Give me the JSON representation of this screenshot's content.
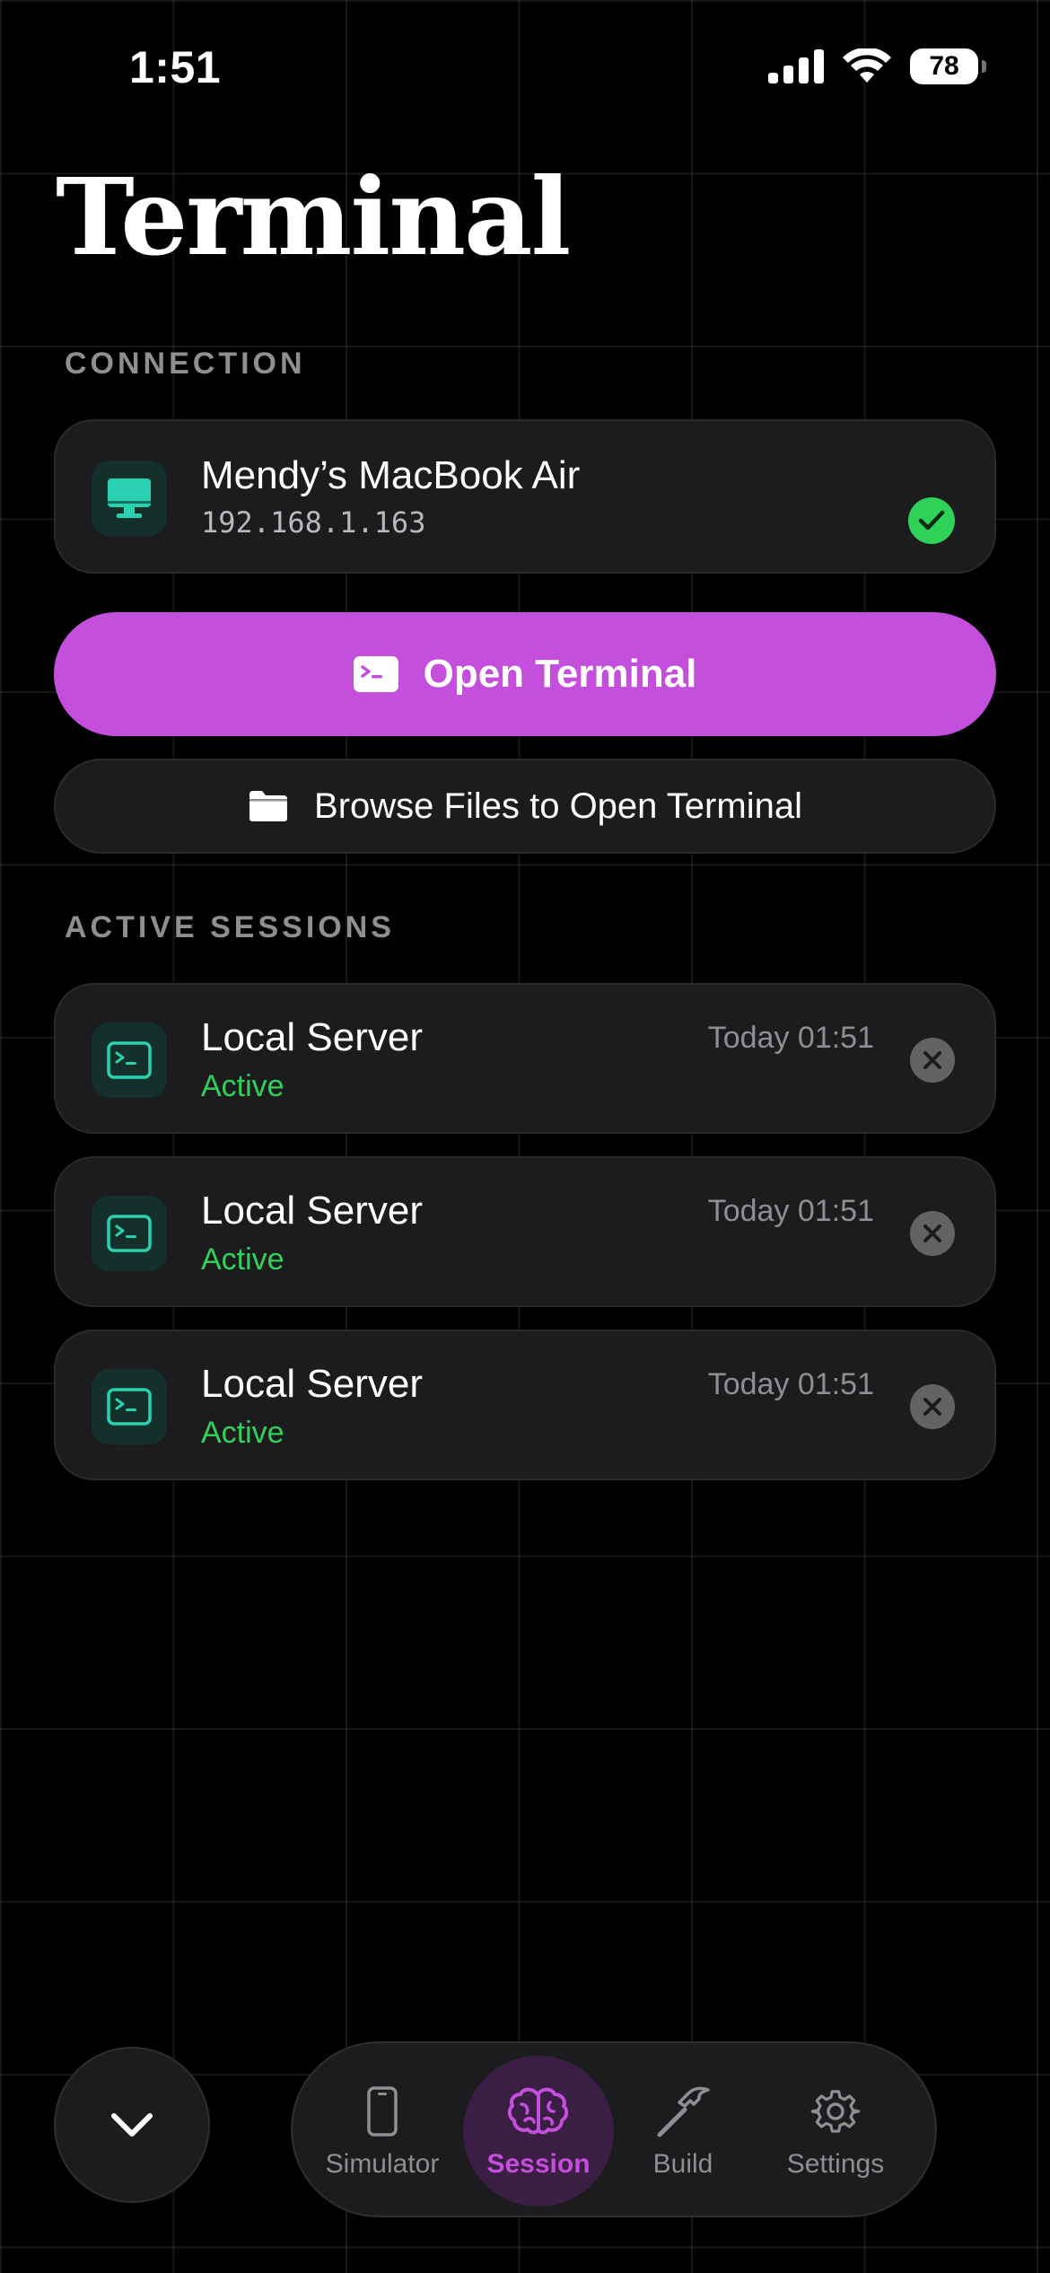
{
  "status_bar": {
    "time": "1:51",
    "battery": "78"
  },
  "page": {
    "title": "Terminal"
  },
  "connection": {
    "section_label": "CONNECTION",
    "device_name": "Mendy’s MacBook Air",
    "ip_address": "192.168.1.163",
    "connected_icon": "check-circle-icon"
  },
  "actions": {
    "open_terminal_label": "Open Terminal",
    "browse_files_label": "Browse Files to Open Terminal"
  },
  "sessions": {
    "section_label": "ACTIVE SESSIONS",
    "items": [
      {
        "name": "Local Server",
        "status": "Active",
        "time": "Today 01:51"
      },
      {
        "name": "Local Server",
        "status": "Active",
        "time": "Today 01:51"
      },
      {
        "name": "Local Server",
        "status": "Active",
        "time": "Today 01:51"
      }
    ]
  },
  "tabbar": {
    "tabs": [
      {
        "label": "Simulator",
        "icon": "phone-icon"
      },
      {
        "label": "Session",
        "icon": "brain-icon",
        "active": true
      },
      {
        "label": "Build",
        "icon": "hammer-icon"
      },
      {
        "label": "Settings",
        "icon": "gear-icon"
      }
    ]
  },
  "colors": {
    "accent": "#c44fdc",
    "success": "#30d158",
    "icon_teal": "#2ad0b0",
    "card_bg": "#1c1c1e"
  }
}
